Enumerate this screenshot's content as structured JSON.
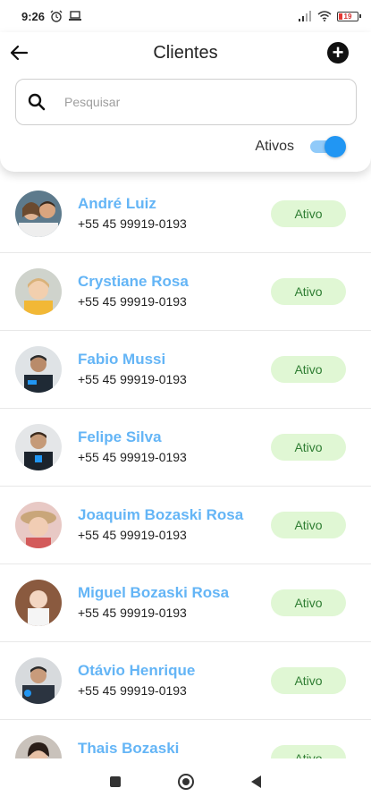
{
  "status_bar": {
    "time": "9:26",
    "battery": "19"
  },
  "header": {
    "title": "Clientes",
    "search_placeholder": "Pesquisar",
    "toggle_label": "Ativos",
    "toggle_on": true
  },
  "colors": {
    "name": "#64b5f6",
    "badge_bg": "#e0f7d4",
    "badge_text": "#2e7d32",
    "switch": "#2196f3"
  },
  "clients": [
    {
      "name": "André Luiz",
      "phone": "+55 45 99919-0193",
      "status": "Ativo"
    },
    {
      "name": "Crystiane Rosa",
      "phone": "+55 45 99919-0193",
      "status": "Ativo"
    },
    {
      "name": "Fabio Mussi",
      "phone": "+55 45 99919-0193",
      "status": "Ativo"
    },
    {
      "name": "Felipe Silva",
      "phone": "+55 45 99919-0193",
      "status": "Ativo"
    },
    {
      "name": "Joaquim Bozaski Rosa",
      "phone": "+55 45 99919-0193",
      "status": "Ativo"
    },
    {
      "name": "Miguel Bozaski Rosa",
      "phone": "+55 45 99919-0193",
      "status": "Ativo"
    },
    {
      "name": "Otávio Henrique",
      "phone": "+55 45 99919-0193",
      "status": "Ativo"
    },
    {
      "name": "Thais Bozaski",
      "phone": "",
      "status": "Ativo"
    }
  ]
}
